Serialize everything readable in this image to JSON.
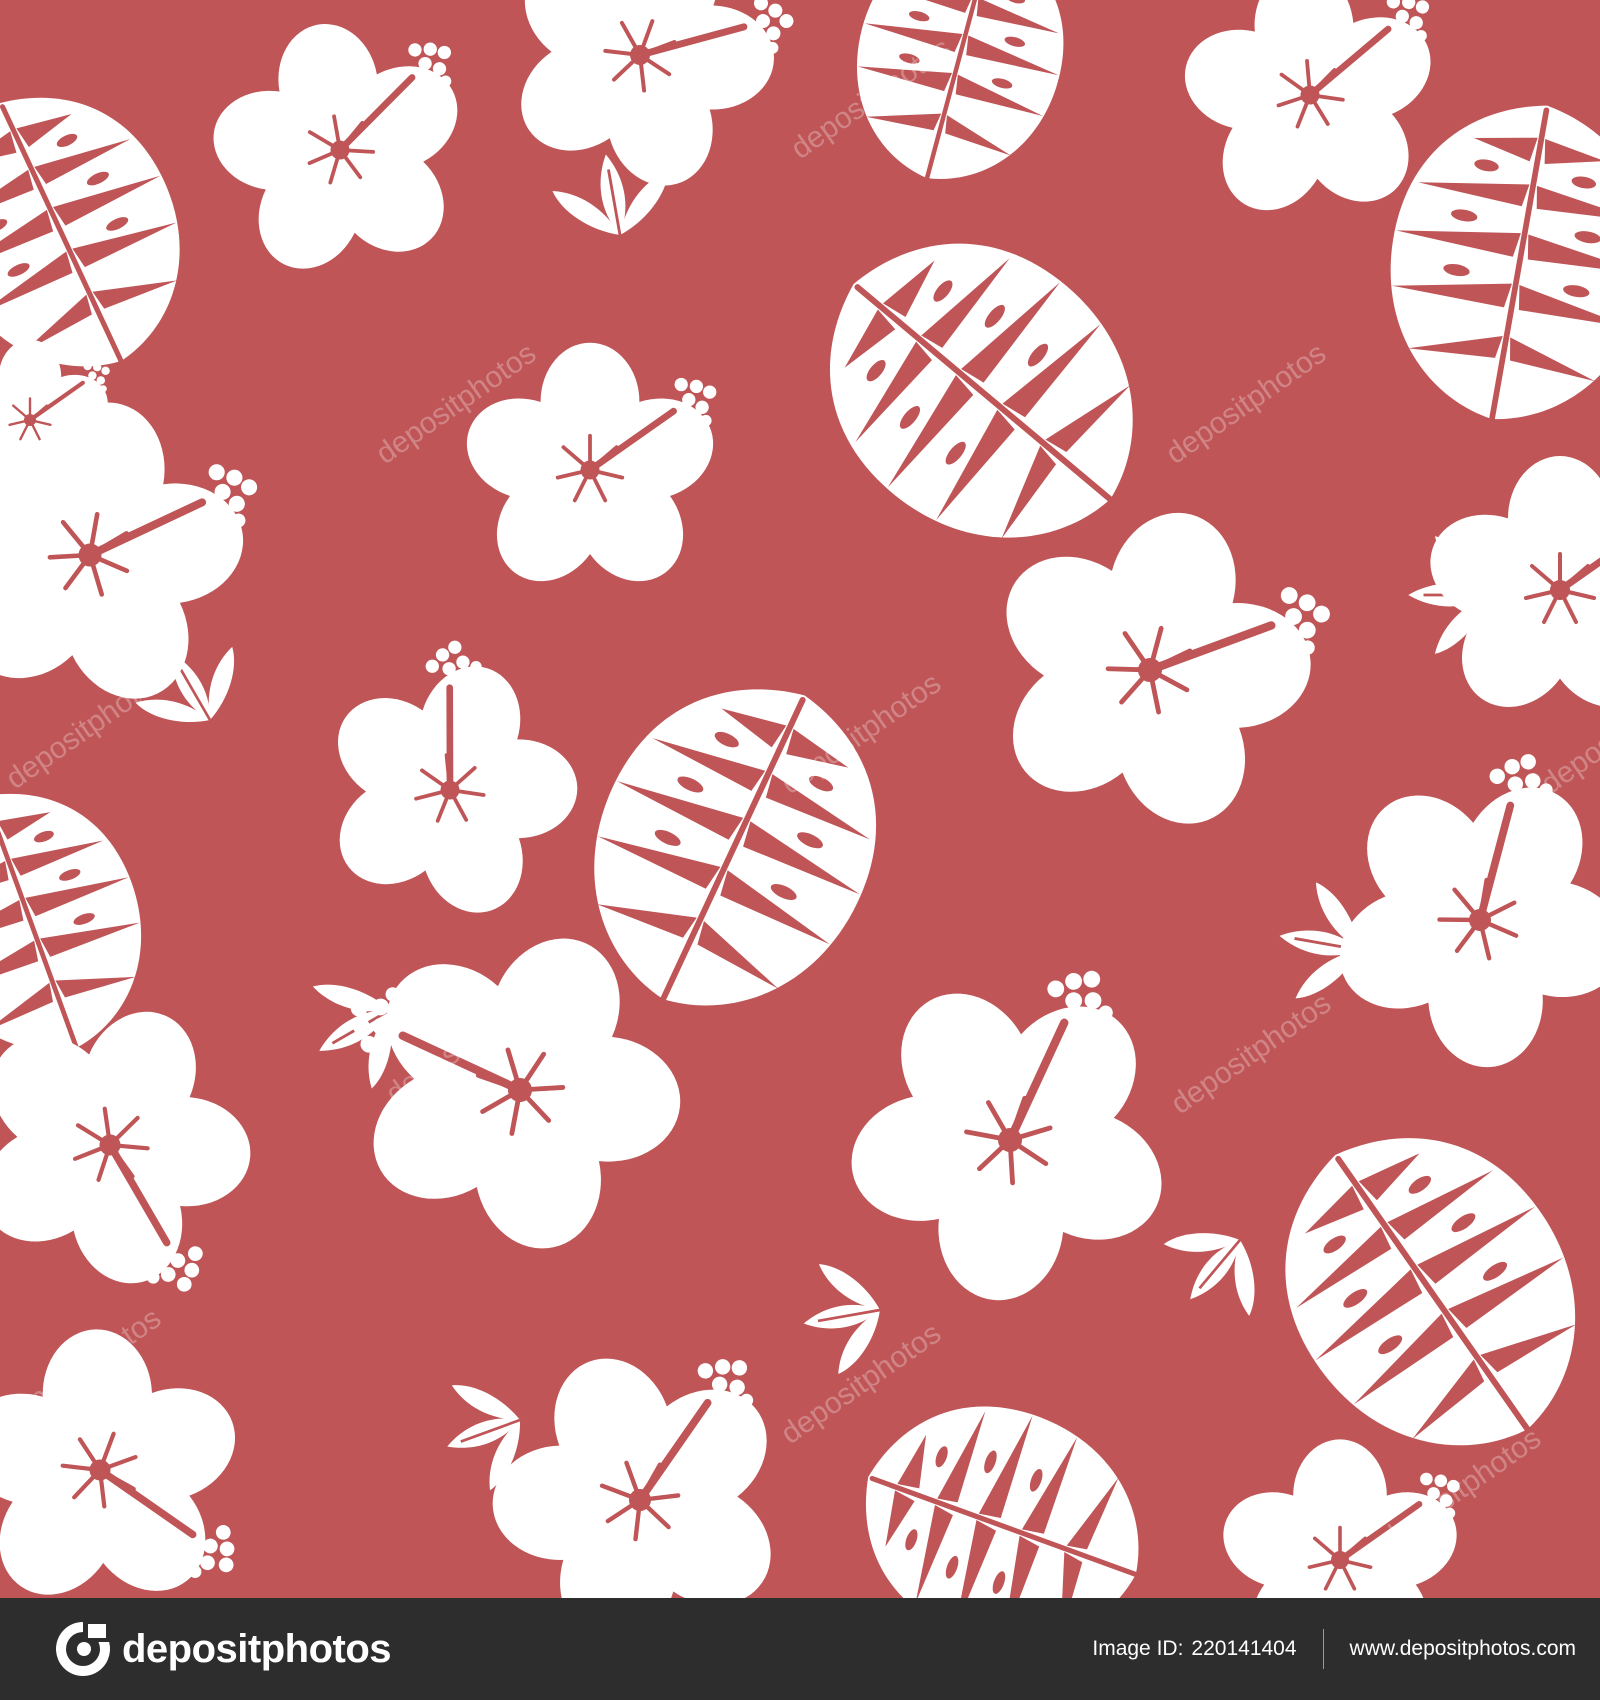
{
  "pattern": {
    "background_color": "#bf5557",
    "motif_color": "#ffffff",
    "motifs": [
      "hibiscus-flower",
      "monstera-leaf",
      "leaf-sprig"
    ]
  },
  "watermark": {
    "text": "depositphotos"
  },
  "footer": {
    "brand": "depositphotos",
    "image_id_label": "Image ID:",
    "image_id": "220141404",
    "url": "www.depositphotos.com",
    "background_color": "#2d2d2d"
  }
}
